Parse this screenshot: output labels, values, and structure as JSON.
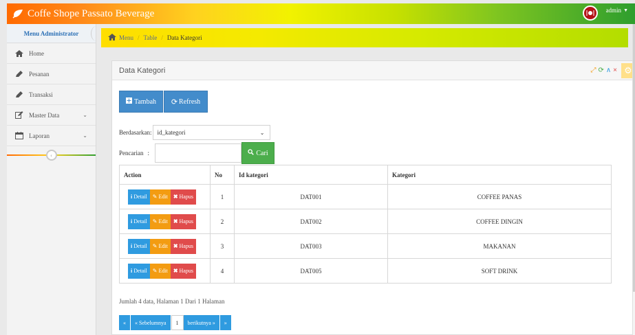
{
  "navbar": {
    "brand": "Coffe Shope Passato Beverage",
    "user": "admin"
  },
  "sidebar": {
    "header": "Menu Administrator",
    "items": [
      {
        "label": "Home",
        "icon": "home-icon"
      },
      {
        "label": "Pesanan",
        "icon": "pencil-icon"
      },
      {
        "label": "Transaksi",
        "icon": "pencil-icon"
      },
      {
        "label": "Master Data",
        "icon": "edit-icon",
        "expandable": true
      },
      {
        "label": "Laporan",
        "icon": "calendar-icon",
        "expandable": true
      }
    ]
  },
  "breadcrumb": [
    "Menu",
    "Table",
    "Data Kategori"
  ],
  "panel": {
    "title": "Data Kategori",
    "buttons": {
      "tambah": "Tambah",
      "refresh": "Refresh"
    },
    "filter": {
      "berdasarkan_label": "Berdasarkan:",
      "berdasarkan_value": "id_kategori",
      "pencarian_label": "Pencarian",
      "pencarian_colon": ":",
      "search_value": "",
      "cari_label": "Cari"
    },
    "table": {
      "headers": [
        "Action",
        "No",
        "Id kategori",
        "Kategori"
      ],
      "action_labels": {
        "detail": "Detail",
        "edit": "Edit",
        "hapus": "Hapus"
      },
      "rows": [
        {
          "no": "1",
          "id": "DAT001",
          "kategori": "COFFEE PANAS"
        },
        {
          "no": "2",
          "id": "DAT002",
          "kategori": "COFFEE DINGIN"
        },
        {
          "no": "3",
          "id": "DAT003",
          "kategori": "MAKANAN"
        },
        {
          "no": "4",
          "id": "DAT005",
          "kategori": "SOFT DRINK"
        }
      ]
    },
    "summary": "Jumlah 4 data, Halaman 1 Dari 1 Halaman",
    "pagination": [
      "«",
      "« Sebelumnya",
      "1",
      "berikutnya »",
      "»"
    ]
  },
  "colors": {
    "action_detail": "#2f9be0",
    "action_edit": "#f39c12",
    "action_hapus": "#e04b4b",
    "primary": "#438ccb",
    "success": "#4cae4c"
  }
}
